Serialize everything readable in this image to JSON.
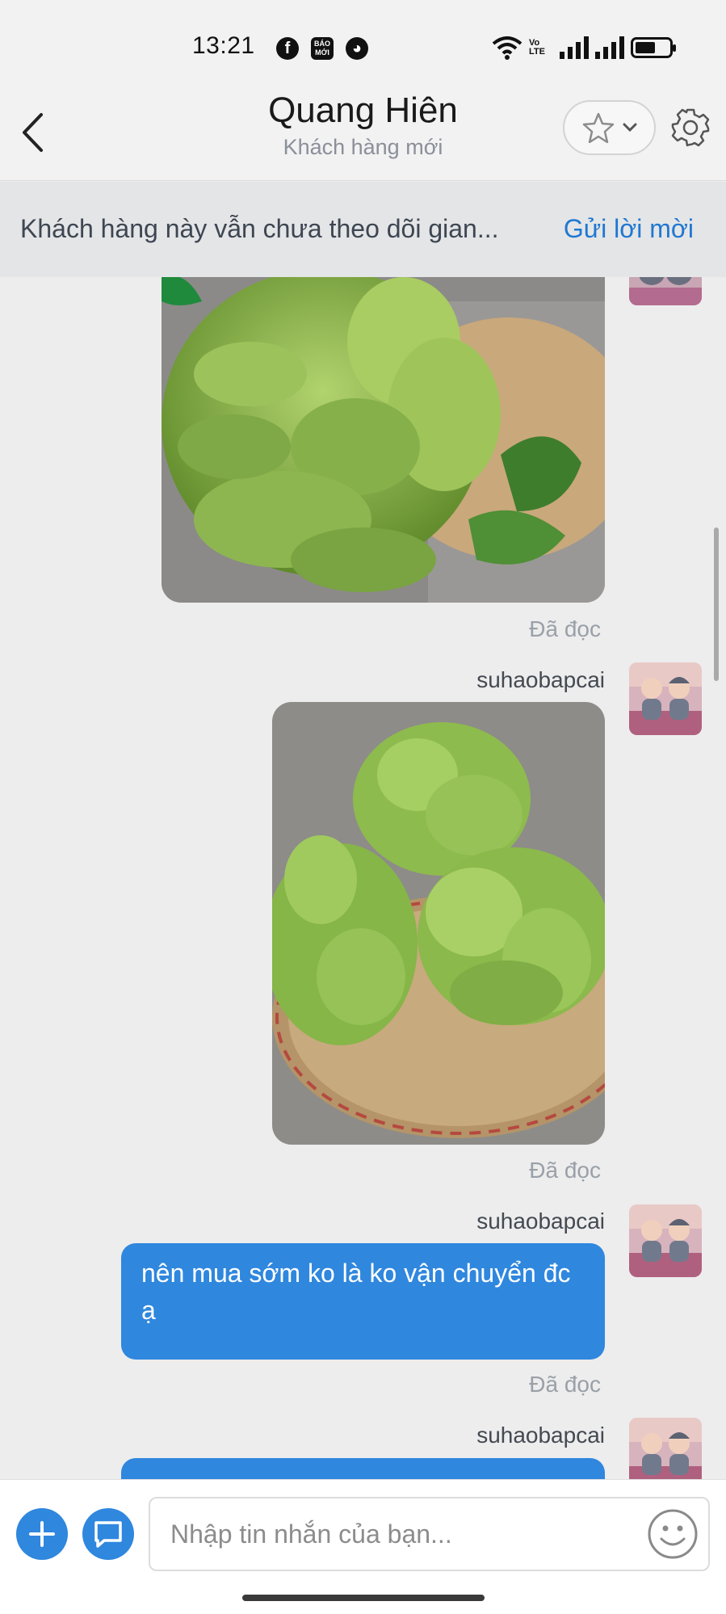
{
  "status_bar": {
    "time": "13:21",
    "apps": [
      "f",
      "BÁO MỚI",
      "◕"
    ],
    "network_label": "Vo LTE",
    "battery_level": 0.6
  },
  "header": {
    "title": "Quang Hiên",
    "subtitle": "Khách hàng mới",
    "icons": [
      "chevron-left-icon",
      "star-icon",
      "chevron-down-icon",
      "gear-icon"
    ]
  },
  "banner": {
    "text": "Khách hàng này vẫn chưa theo dõi gian...",
    "action_label": "Gửi lời mời"
  },
  "messages": [
    {
      "type": "image",
      "subject": "green Buddha's hand citrus fruits",
      "status": "Đã đọc"
    },
    {
      "type": "image",
      "sender": "suhaobapcai",
      "subject": "Buddha's hand fruits on woven bamboo tray",
      "status": "Đã đọc"
    },
    {
      "type": "text",
      "sender": "suhaobapcai",
      "text": "nên mua sớm ko là ko vận chuyển đc ạ",
      "status": "Đã đọc"
    },
    {
      "type": "text",
      "sender": "suhaobapcai",
      "text": ""
    }
  ],
  "composer": {
    "placeholder": "Nhập tin nhắn của bạn...",
    "icons": [
      "plus-icon",
      "chat-bubble-icon",
      "emoji-icon"
    ]
  },
  "colors": {
    "accent": "#2f87de",
    "link": "#1f78d1",
    "background": "#ededed"
  }
}
